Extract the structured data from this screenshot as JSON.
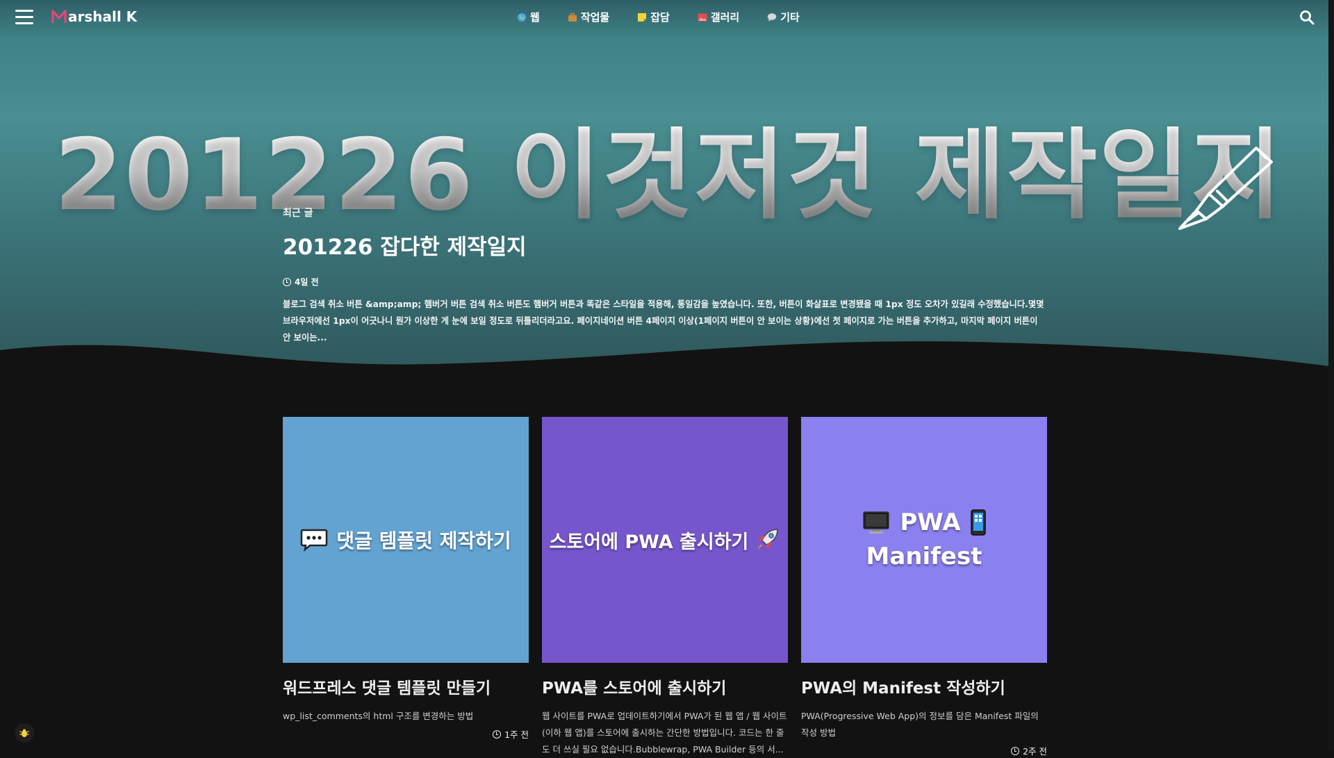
{
  "site": {
    "logo_text": "arshall K",
    "accent_color": "#e8457b"
  },
  "nav": {
    "items": [
      {
        "label": "웹",
        "icon": "globe-icon"
      },
      {
        "label": "작업물",
        "icon": "briefcase-icon"
      },
      {
        "label": "잡담",
        "icon": "note-icon"
      },
      {
        "label": "갤러리",
        "icon": "picture-icon"
      },
      {
        "label": "기타",
        "icon": "speech-bubble-icon"
      }
    ]
  },
  "hero": {
    "banner_text": "201226 이것저것 제작일지",
    "section_label": "최근 글",
    "title": "201226 잡다한 제작일지",
    "time": "4일 전",
    "excerpt": "블로그 검색 취소 버튼 &amp;amp; 햄버거 버튼 검색 취소 버튼도 햄버거 버튼과 똑같은 스타일을 적용해, 통일감을 높였습니다. 또한, 버튼이 화살표로 변경됐을 때 1px 정도 오차가 있길래 수정했습니다.몇몇 브라우저에선 1px이 어긋나니 뭔가 이상한 게 눈에 보일 정도로 뒤틀리더라고요. 페이지네이션 버튼 4페이지 이상(1페이지 버튼이 안 보이는 상황)에선 첫 페이지로 가는 버튼을 추가하고, 마지막 페이지 버튼이 안 보이는..."
  },
  "cards": [
    {
      "thumb_text": "댓글 템플릿 제작하기",
      "thumb_icon": "speech-bubble-icon",
      "thumb_color": "#62a3d2",
      "title": "워드프레스 댓글 템플릿 만들기",
      "description": "wp_list_comments의 html 구조를 변경하는 방법",
      "time": "1주 전"
    },
    {
      "thumb_text": "스토어에 PWA 출시하기",
      "thumb_icon": "rocket-icon",
      "thumb_color": "#7656cc",
      "title": "PWA를 스토어에 출시하기",
      "description": "웹 사이트를 PWA로 업데이트하기에서 PWA가 된 웹 앱 / 웹 사이트(이하 웹 앱)를 스토어에 출시하는 간단한 방법입니다. 코드는 한 줄도 더 쓰실 필요 없습니다.Bubblewrap, PWA Builder 등의 서...",
      "time": ""
    },
    {
      "thumb_text_line1": "PWA",
      "thumb_text_line2": "Manifest",
      "thumb_icon_left": "monitor-icon",
      "thumb_icon_right": "mobile-phone-icon",
      "thumb_color": "#8b80f0",
      "title": "PWA의 Manifest 작성하기",
      "description": "PWA(Progressive Web App)의 정보를 담은 Manifest 파일의 작성 방법",
      "time": "2주 전"
    }
  ]
}
